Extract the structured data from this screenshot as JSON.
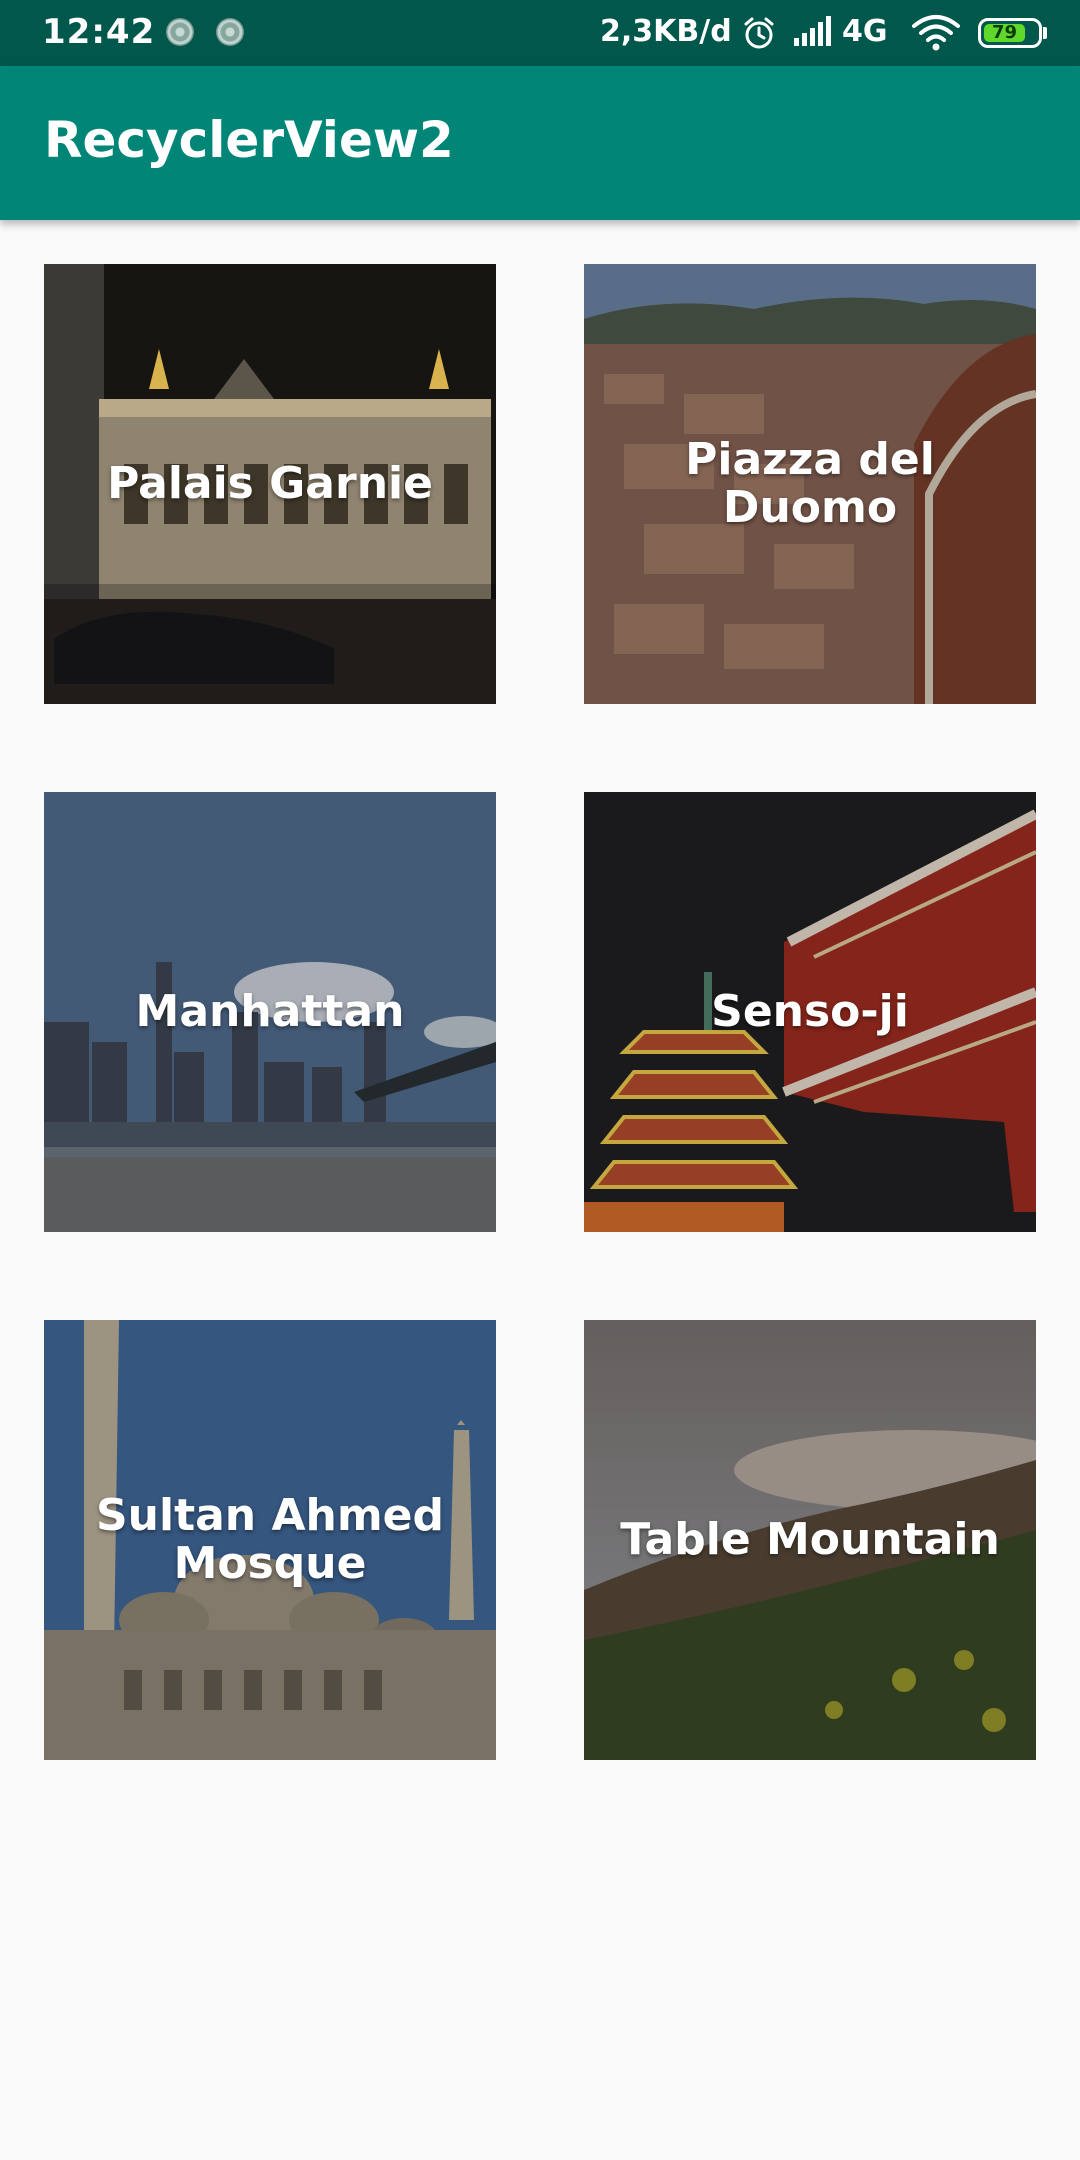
{
  "status_bar": {
    "time": "12:42",
    "network_speed": "2,3KB/d",
    "network_type": "4G",
    "battery_level": "79",
    "icons": [
      "notification-icon",
      "notification-icon",
      "alarm-icon",
      "signal-icon",
      "wifi-icon",
      "battery-icon"
    ],
    "background_color": "#00584c"
  },
  "app_bar": {
    "title": "RecyclerView2",
    "background_color": "#008577"
  },
  "grid": {
    "items": [
      {
        "label": "Palais Garnie",
        "image": "palais-garnier-photo"
      },
      {
        "label": "Piazza del Duomo",
        "image": "piazza-del-duomo-photo"
      },
      {
        "label": "Manhattan",
        "image": "manhattan-photo"
      },
      {
        "label": "Senso-ji",
        "image": "senso-ji-photo"
      },
      {
        "label": "Sultan Ahmed Mosque",
        "image": "sultan-ahmed-mosque-photo"
      },
      {
        "label": "Table Mountain",
        "image": "table-mountain-photo"
      }
    ]
  }
}
